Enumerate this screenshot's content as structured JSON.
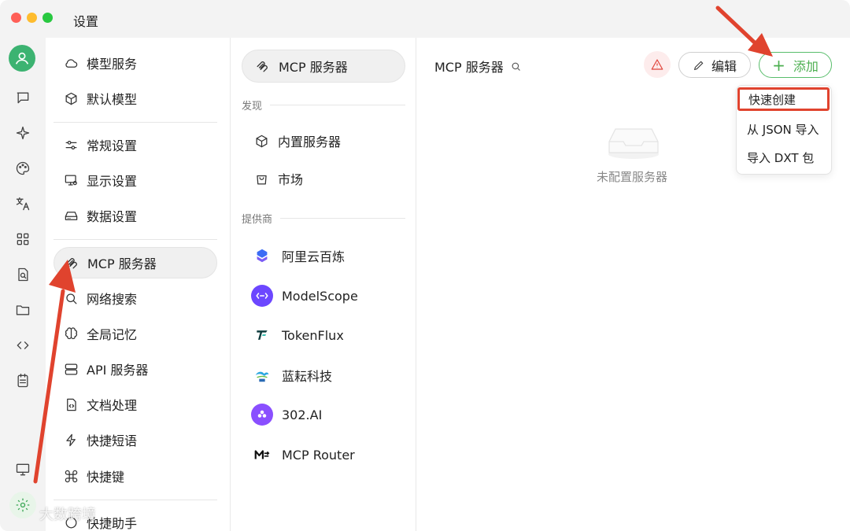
{
  "window": {
    "title": "设置"
  },
  "nav": {
    "items": [
      {
        "label": "模型服务"
      },
      {
        "label": "默认模型"
      },
      {
        "label": "常规设置"
      },
      {
        "label": "显示设置"
      },
      {
        "label": "数据设置"
      },
      {
        "label": "MCP 服务器"
      },
      {
        "label": "网络搜索"
      },
      {
        "label": "全局记忆"
      },
      {
        "label": "API 服务器"
      },
      {
        "label": "文档处理"
      },
      {
        "label": "快捷短语"
      },
      {
        "label": "快捷键"
      },
      {
        "label": "快捷助手"
      }
    ],
    "active": "MCP 服务器"
  },
  "mcp": {
    "header": "MCP 服务器",
    "discover_label": "发现",
    "discover": [
      {
        "label": "内置服务器"
      },
      {
        "label": "市场"
      }
    ],
    "providers_label": "提供商",
    "providers": [
      {
        "label": "阿里云百炼",
        "color": "#3b6cf5"
      },
      {
        "label": "ModelScope",
        "color": "#6c47ff"
      },
      {
        "label": "TokenFlux",
        "color": "#0f3d3e"
      },
      {
        "label": "蓝耘科技",
        "color": "#2aa6e0"
      },
      {
        "label": "302.AI",
        "color": "#8a4fff"
      },
      {
        "label": "MCP Router",
        "color": "#111111"
      }
    ]
  },
  "main": {
    "title": "MCP 服务器",
    "edit_label": "编辑",
    "add_label": "添加",
    "empty_text": "未配置服务器",
    "add_menu": [
      {
        "label": "快速创建"
      },
      {
        "label": "从 JSON 导入"
      },
      {
        "label": "导入 DXT 包"
      }
    ]
  },
  "watermark": "大数跨境",
  "colors": {
    "accent": "#4caf50",
    "annotation": "#e0432e"
  }
}
